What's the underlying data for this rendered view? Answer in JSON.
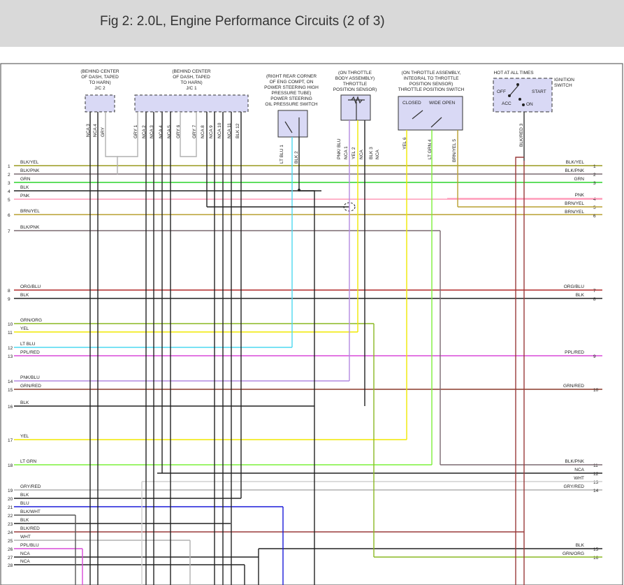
{
  "header": {
    "title": "Fig 2: 2.0L, Engine Performance Circuits (2 of 3)"
  },
  "components": [
    {
      "id": "jc2",
      "lines": [
        "(BEHIND CENTER",
        "OF DASH, TAPED",
        "TO HARN)",
        "J/C 2"
      ]
    },
    {
      "id": "jc1",
      "lines": [
        "(BEHIND CENTER",
        "OF DASH, TAPED",
        "TO HARN)",
        "J/C 1"
      ]
    },
    {
      "id": "ps",
      "lines": [
        "(RIGHT REAR CORNER",
        "OF ENG COMPT, ON",
        "POWER STEERING HIGH",
        "PRESSURE TUBE)",
        "POWER STEERING",
        "OIL PRESSURE SWITCH"
      ]
    },
    {
      "id": "tps",
      "lines": [
        "(ON THROTTLE",
        "BODY ASSEMBLY)",
        "THROTTLE",
        "POSITION SENSOR)"
      ]
    },
    {
      "id": "tpsw",
      "lines": [
        "(ON THROTTLE ASSEMBLY,",
        "INTEGRAL TO THROTTLE",
        "POSITION SENSOR)",
        "THROTTLE POSITION SWITCH"
      ]
    },
    {
      "id": "ign",
      "lines": [
        "HOT AT ALL TIMES"
      ]
    },
    {
      "id": "ign2",
      "lines": [
        "IGNITION",
        "SWITCH"
      ]
    }
  ],
  "switch_labels": {
    "closed": "CLOSED",
    "wide_open": "WIDE OPEN",
    "off": "OFF",
    "acc": "ACC",
    "on": "ON",
    "start": "START"
  },
  "pins": [
    {
      "t": "NCA 3",
      "c": "jc2"
    },
    {
      "t": "NCA 4",
      "c": "jc2"
    },
    {
      "t": "GRY",
      "c": "jc2"
    },
    {
      "t": "GRY 1",
      "c": "jc1"
    },
    {
      "t": "NCA 2",
      "c": "jc1"
    },
    {
      "t": "NCA 3",
      "c": "jc1"
    },
    {
      "t": "NCA 4",
      "c": "jc1"
    },
    {
      "t": "NCA 5",
      "c": "jc1"
    },
    {
      "t": "GRY 6",
      "c": "jc1"
    },
    {
      "t": "GRY 7",
      "c": "jc1"
    },
    {
      "t": "NCA 8",
      "c": "jc1"
    },
    {
      "t": "NCA 9",
      "c": "jc1"
    },
    {
      "t": "NCA 10",
      "c": "jc1"
    },
    {
      "t": "NCA 11",
      "c": "jc1"
    },
    {
      "t": "BLK 12",
      "c": "jc1"
    },
    {
      "t": "LT BLU 1",
      "c": "ps"
    },
    {
      "t": "BLK 2",
      "c": "ps"
    },
    {
      "t": "PNK/ BLU",
      "c": "tps"
    },
    {
      "t": "NCA 1",
      "c": "tps"
    },
    {
      "t": "YEL 2",
      "c": "tps"
    },
    {
      "t": "NCA",
      "c": "tps"
    },
    {
      "t": "BLK 3",
      "c": "tps"
    },
    {
      "t": "NCA",
      "c": "tps"
    },
    {
      "t": "YEL 6",
      "c": "tpsw"
    },
    {
      "t": "LT GRN 4",
      "c": "tpsw"
    },
    {
      "t": "BRN/YEL 5",
      "c": "tpsw"
    },
    {
      "t": "BLK/RED 3",
      "c": "ign"
    }
  ],
  "wire_colors": {
    "blk": "#222222",
    "gry": "#b0b0b0",
    "yel": "#f0e800",
    "grn": "#2bd42b",
    "ltgrn": "#7cf03a",
    "pnk": "#ff9ab8",
    "ltblu": "#4dd8f0",
    "blu": "#1a1ad8",
    "ppl": "#d84ad8",
    "pnkblu": "#b48ae0",
    "brnyel": "#b8a030",
    "blkyel": "#9a9a1e",
    "blkpnk": "#7a6a70",
    "orgblu": "#b22a2a",
    "grnred": "#8a3a2a",
    "grnorg": "#8ab822",
    "blkred": "#9a3a3a",
    "grnyel": "#6aa01e",
    "blkwht": "#555555"
  },
  "left_rows": [
    {
      "n": "1",
      "l": "BLK/YEL"
    },
    {
      "n": "2",
      "l": "BLK/PNK"
    },
    {
      "n": "3",
      "l": "GRN"
    },
    {
      "n": "4",
      "l": "BLK"
    },
    {
      "n": "5",
      "l": "PNK"
    },
    {
      "n": "6",
      "l": "BRN/YEL"
    },
    {
      "n": "7",
      "l": "BLK/PNK"
    },
    {
      "n": "8",
      "l": "ORG/BLU"
    },
    {
      "n": "9",
      "l": "BLK"
    },
    {
      "n": "10",
      "l": "GRN/ORG"
    },
    {
      "n": "11",
      "l": "YEL"
    },
    {
      "n": "12",
      "l": "LT BLU"
    },
    {
      "n": "13",
      "l": "PPL/RED"
    },
    {
      "n": "14",
      "l": "PNK/BLU"
    },
    {
      "n": "15",
      "l": "GRN/RED"
    },
    {
      "n": "16",
      "l": "BLK"
    },
    {
      "n": "17",
      "l": "YEL"
    },
    {
      "n": "18",
      "l": "LT GRN"
    },
    {
      "n": "19",
      "l": "GRY/RED"
    },
    {
      "n": "20",
      "l": "BLK"
    },
    {
      "n": "21",
      "l": "BLU"
    },
    {
      "n": "22",
      "l": "BLK/WHT"
    },
    {
      "n": "23",
      "l": "BLK"
    },
    {
      "n": "24",
      "l": "BLK/RED"
    },
    {
      "n": "25",
      "l": "WHT"
    },
    {
      "n": "26",
      "l": "PPL/BLU"
    },
    {
      "n": "27",
      "l": "NCA"
    },
    {
      "n": "28",
      "l": "NCA"
    }
  ],
  "right_rows": [
    {
      "n": "1",
      "l": "BLK/YEL"
    },
    {
      "n": "2",
      "l": "BLK/PNK"
    },
    {
      "n": "3",
      "l": "GRN"
    },
    {
      "n": "4",
      "l": "PNK"
    },
    {
      "n": "5",
      "l": "BRN/YEL"
    },
    {
      "n": "6",
      "l": "BRN/YEL"
    },
    {
      "n": "7",
      "l": "ORG/BLU"
    },
    {
      "n": "8",
      "l": "BLK"
    },
    {
      "n": "9",
      "l": "PPL/RED"
    },
    {
      "n": "10",
      "l": "GRN/RED"
    },
    {
      "n": "11",
      "l": "BLK/PNK"
    },
    {
      "n": "12",
      "l": "NCA"
    },
    {
      "n": "13",
      "l": "WHT"
    },
    {
      "n": "14",
      "l": "GRY/RED"
    },
    {
      "n": "15",
      "l": "BLK"
    },
    {
      "n": "16",
      "l": "GRN/ORG"
    }
  ]
}
